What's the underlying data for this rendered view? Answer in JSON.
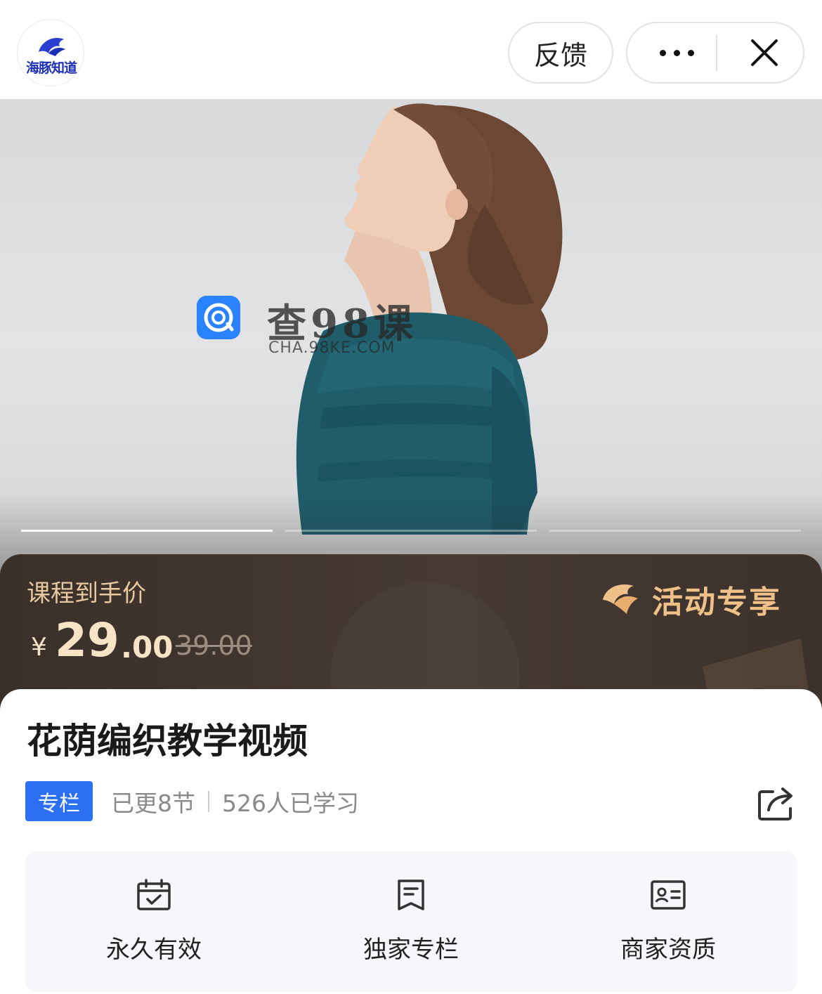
{
  "header": {
    "logo_text": "海豚知道",
    "feedback_label": "反馈",
    "more_icon": "more-dots-icon",
    "close_icon": "close-icon"
  },
  "hero": {
    "watermark_title": "查98课",
    "watermark_sub": "CHA.98KE.COM",
    "slides_total": 3,
    "active_slide": 1
  },
  "price": {
    "label": "课程到手价",
    "currency": "¥",
    "integer": "29",
    "decimal": ".00",
    "original": "39.00",
    "promo": "活动专享"
  },
  "course": {
    "title": "花荫编织教学视频",
    "tag": "专栏",
    "updated": "已更8节",
    "learners": "526人已学习"
  },
  "features": [
    {
      "label": "永久有效",
      "icon": "calendar-check-icon"
    },
    {
      "label": "独家专栏",
      "icon": "bookmark-doc-icon"
    },
    {
      "label": "商家资质",
      "icon": "id-card-icon"
    }
  ],
  "colors": {
    "accent_blue": "#2d6ff3",
    "price_gold": "#f7e4c6",
    "promo_gold": "#f0c089",
    "panel_brown": "#3a2f29"
  }
}
